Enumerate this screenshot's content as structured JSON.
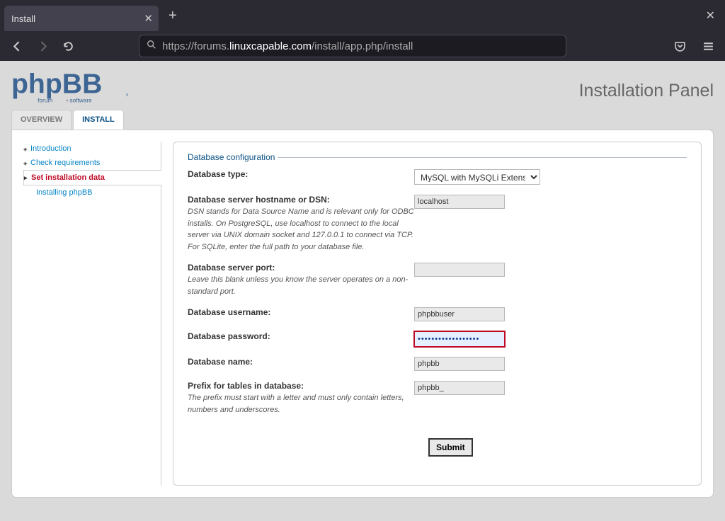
{
  "browser": {
    "tab_title": "Install",
    "url_prefix": "https://forums.",
    "url_domain": "linuxcapable.com",
    "url_suffix": "/install/app.php/install"
  },
  "header": {
    "logo_text": "phpBB",
    "logo_subtitle": "forum · software",
    "title": "Installation Panel"
  },
  "tabs": [
    {
      "label": "OVERVIEW",
      "active": false
    },
    {
      "label": "INSTALL",
      "active": true
    }
  ],
  "sidebar": {
    "items": [
      {
        "label": "Introduction",
        "active": false
      },
      {
        "label": "Check requirements",
        "active": false
      },
      {
        "label": "Set installation data",
        "active": true
      },
      {
        "label": "Installing phpBB",
        "active": false,
        "sub": true
      }
    ]
  },
  "form": {
    "legend": "Database configuration",
    "dbtype": {
      "label": "Database type:",
      "selected": "MySQL with MySQLi Extension",
      "options": [
        "MySQL with MySQLi Extension"
      ]
    },
    "dbhost": {
      "label": "Database server hostname or DSN:",
      "hint": "DSN stands for Data Source Name and is relevant only for ODBC installs. On PostgreSQL, use localhost to connect to the local server via UNIX domain socket and 127.0.0.1 to connect via TCP. For SQLite, enter the full path to your database file.",
      "value": "localhost"
    },
    "dbport": {
      "label": "Database server port:",
      "hint": "Leave this blank unless you know the server operates on a non-standard port.",
      "value": ""
    },
    "dbuser": {
      "label": "Database username:",
      "value": "phpbbuser"
    },
    "dbpass": {
      "label": "Database password:",
      "value": "••••••••••••••••••"
    },
    "dbname": {
      "label": "Database name:",
      "value": "phpbb"
    },
    "dbprefix": {
      "label": "Prefix for tables in database:",
      "hint": "The prefix must start with a letter and must only contain letters, numbers and underscores.",
      "value": "phpbb_"
    },
    "submit": "Submit"
  }
}
